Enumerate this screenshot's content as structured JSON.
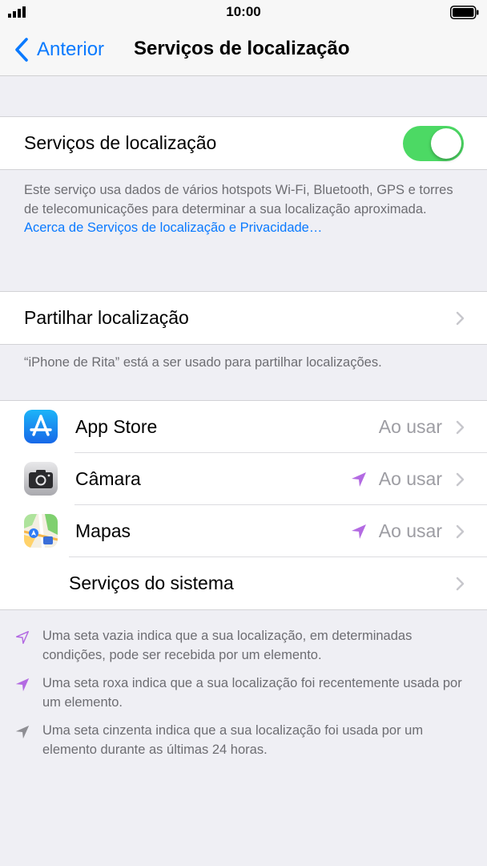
{
  "status_bar": {
    "time": "10:00"
  },
  "nav": {
    "back_label": "Anterior",
    "title": "Serviços de localização"
  },
  "main_toggle": {
    "label": "Serviços de localização",
    "on": true
  },
  "description": {
    "text": "Este serviço usa dados de vários hotspots Wi-Fi, Bluetooth, GPS e torres de telecomunicações para determinar a sua localização aproximada. ",
    "link": "Acerca de Serviços de localização e Privacidade…"
  },
  "share": {
    "label": "Partilhar localização",
    "footnote": "“iPhone de Rita” está a ser usado para partilhar localizações."
  },
  "apps": [
    {
      "name": "App Store",
      "value": "Ao usar",
      "icon": "app-store-icon",
      "arrow": false
    },
    {
      "name": "Câmara",
      "value": "Ao usar",
      "icon": "camera-icon",
      "arrow": true
    },
    {
      "name": "Mapas",
      "value": "Ao usar",
      "icon": "maps-icon",
      "arrow": true
    }
  ],
  "system_services": {
    "label": "Serviços do sistema"
  },
  "legend": [
    {
      "icon": "hollow-arrow-icon",
      "text": "Uma seta vazia indica que a sua localização, em determinadas condições, pode ser recebida por um elemento."
    },
    {
      "icon": "purple-arrow-icon",
      "text": "Uma seta roxa indica que a sua localização foi recentemente usada por um elemento."
    },
    {
      "icon": "gray-arrow-icon",
      "text": "Uma seta cinzenta indica que a sua localização foi usada por um elemento durante as últimas 24 horas."
    }
  ],
  "colors": {
    "accent": "#0a7aff",
    "toggle_on": "#4cd964",
    "location_arrow": "#b36ae2",
    "gray_arrow": "#8e8e93",
    "background": "#efeff4"
  }
}
